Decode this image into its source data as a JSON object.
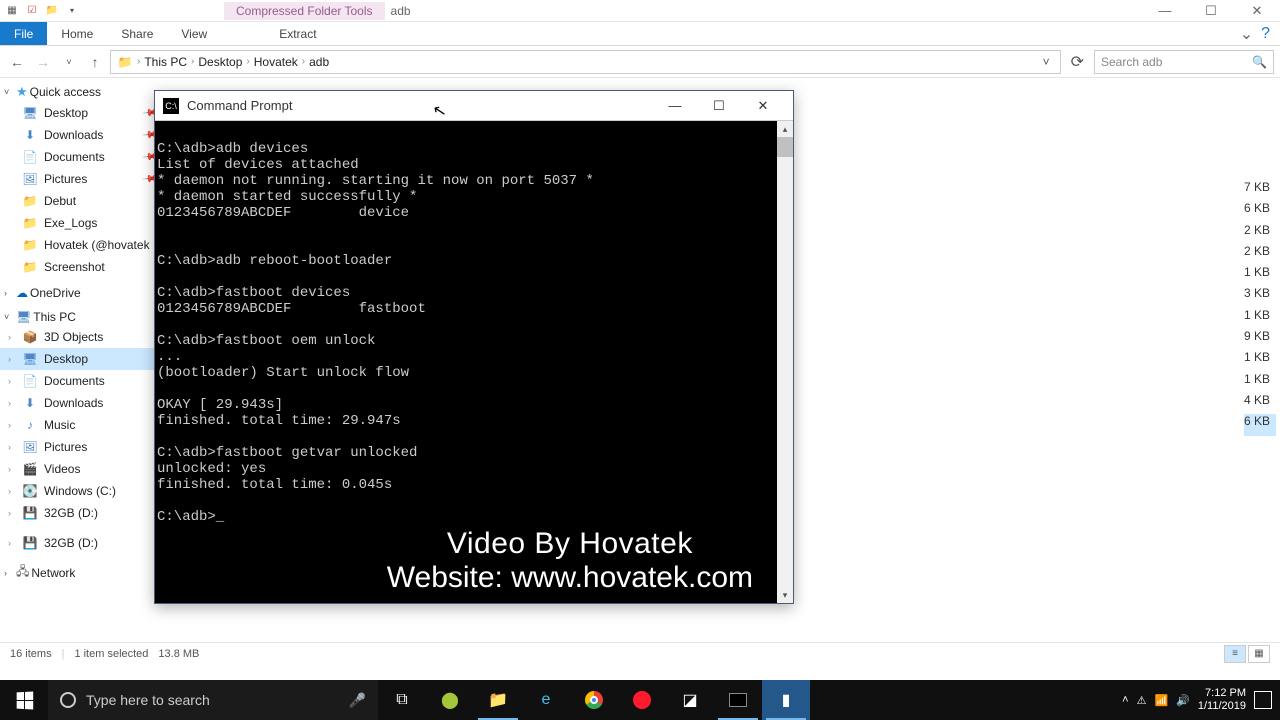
{
  "titlebar": {
    "context_tab": "Compressed Folder Tools",
    "title": "adb"
  },
  "ribbon": {
    "tabs": [
      "File",
      "Home",
      "Share",
      "View"
    ],
    "context_tab": "Extract"
  },
  "nav": {
    "breadcrumb": [
      "This PC",
      "Desktop",
      "Hovatek",
      "adb"
    ]
  },
  "search": {
    "placeholder": "Search adb"
  },
  "navpane": {
    "quick_access": "Quick access",
    "quick_items": [
      "Desktop",
      "Downloads",
      "Documents",
      "Pictures",
      "Debut",
      "Exe_Logs",
      "Hovatek (@hovatek",
      "Screenshot"
    ],
    "onedrive": "OneDrive",
    "thispc": "This PC",
    "pc_items": [
      "3D Objects",
      "Desktop",
      "Documents",
      "Downloads",
      "Music",
      "Pictures",
      "Videos",
      "Windows (C:)",
      "32GB (D:)",
      "32GB (D:)"
    ],
    "network": "Network"
  },
  "files": {
    "sizes": [
      "7 KB",
      "6 KB",
      "2 KB",
      "2 KB",
      "1 KB",
      "3 KB",
      "1 KB",
      "9 KB",
      "1 KB",
      "1 KB",
      "4 KB",
      "6 KB"
    ]
  },
  "status": {
    "count": "16 items",
    "sel": "1 item selected",
    "size": "13.8 MB"
  },
  "cmd": {
    "title": "Command Prompt",
    "body": "\nC:\\adb>adb devices\nList of devices attached\n* daemon not running. starting it now on port 5037 *\n* daemon started successfully *\n0123456789ABCDEF        device\n\n\nC:\\adb>adb reboot-bootloader\n\nC:\\adb>fastboot devices\n0123456789ABCDEF        fastboot\n\nC:\\adb>fastboot oem unlock\n...\n(bootloader) Start unlock flow\n\nOKAY [ 29.943s]\nfinished. total time: 29.947s\n\nC:\\adb>fastboot getvar unlocked\nunlocked: yes\nfinished. total time: 0.045s\n\nC:\\adb>_",
    "overlay_l1": "Video By Hovatek",
    "overlay_l2": "Website: www.hovatek.com"
  },
  "taskbar": {
    "search_placeholder": "Type here to search",
    "time": "7:12 PM",
    "date": "1/11/2019"
  }
}
